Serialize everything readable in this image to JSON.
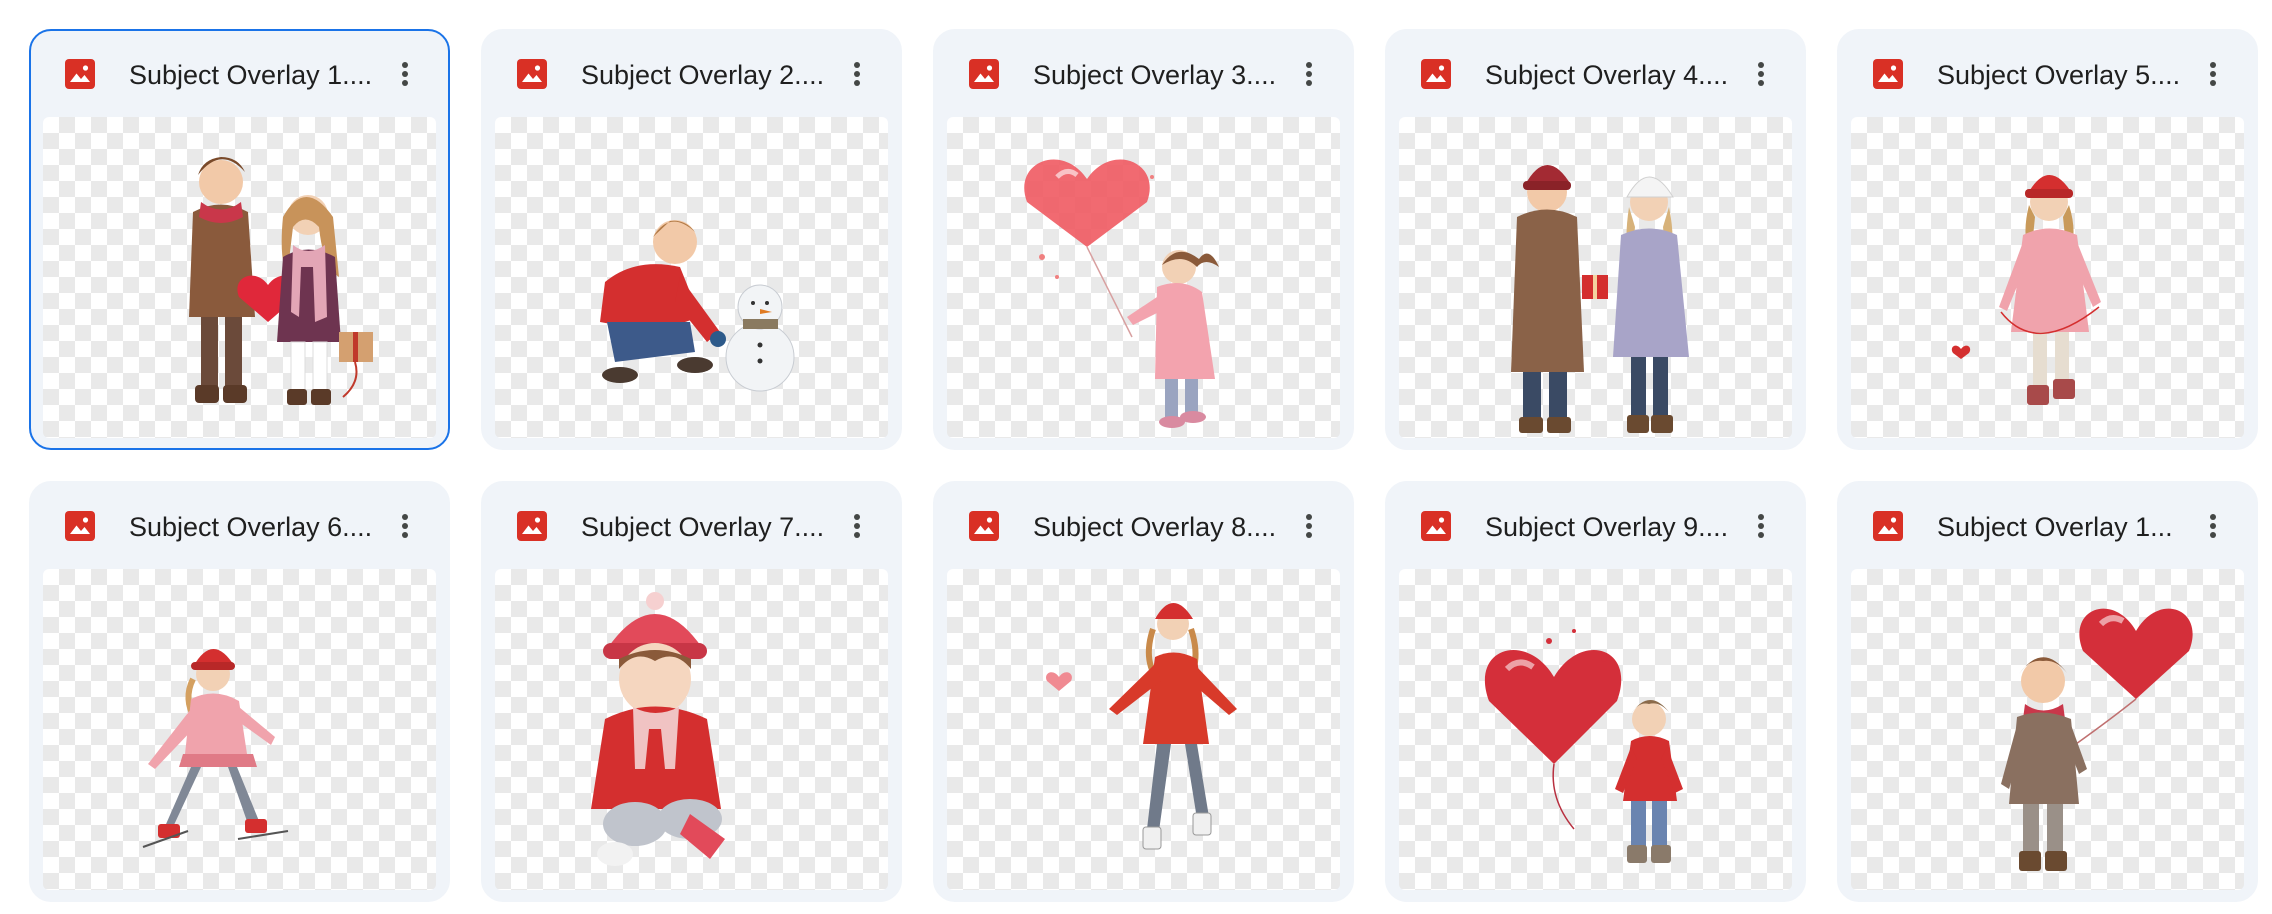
{
  "files": [
    {
      "name": "Subject Overlay 1....",
      "selected": true,
      "icon": "image-file-icon",
      "subject": "boy-and-girl-with-heart-and-gift"
    },
    {
      "name": "Subject Overlay 2....",
      "selected": false,
      "icon": "image-file-icon",
      "subject": "boy-building-snowman"
    },
    {
      "name": "Subject Overlay 3....",
      "selected": false,
      "icon": "image-file-icon",
      "subject": "girl-with-heart-balloon"
    },
    {
      "name": "Subject Overlay 4....",
      "selected": false,
      "icon": "image-file-icon",
      "subject": "two-children-exchanging-gift"
    },
    {
      "name": "Subject Overlay 5....",
      "selected": false,
      "icon": "image-file-icon",
      "subject": "girl-skating"
    },
    {
      "name": "Subject Overlay 6....",
      "selected": false,
      "icon": "image-file-icon",
      "subject": "girl-ice-skating"
    },
    {
      "name": "Subject Overlay 7....",
      "selected": false,
      "icon": "image-file-icon",
      "subject": "girl-sitting-in-snow"
    },
    {
      "name": "Subject Overlay 8....",
      "selected": false,
      "icon": "image-file-icon",
      "subject": "girl-skating-with-heart"
    },
    {
      "name": "Subject Overlay 9....",
      "selected": false,
      "icon": "image-file-icon",
      "subject": "boy-with-big-heart"
    },
    {
      "name": "Subject Overlay 1...",
      "selected": false,
      "icon": "image-file-icon",
      "subject": "boy-with-heart-balloon"
    }
  ],
  "colors": {
    "card_bg": "#f0f4f9",
    "selected_border": "#1a73e8",
    "image_icon": "#d93025",
    "text": "#1f1f1f",
    "checker": "#e9e9e9"
  },
  "icons": {
    "file_type": "image-file-icon",
    "more": "more-vert-icon"
  }
}
